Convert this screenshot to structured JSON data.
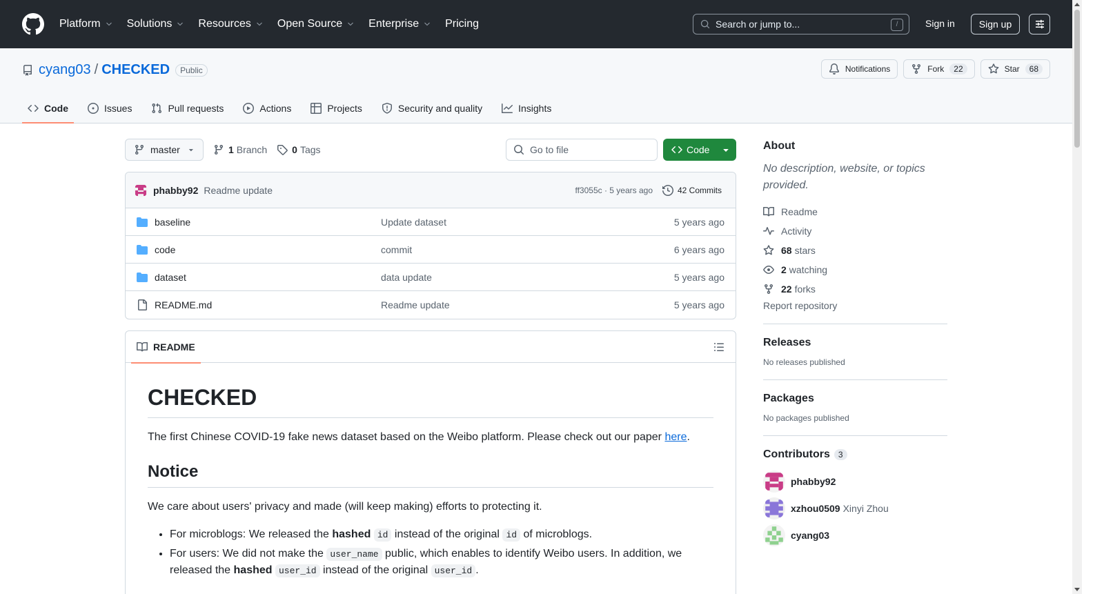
{
  "header": {
    "nav": [
      "Platform",
      "Solutions",
      "Resources",
      "Open Source",
      "Enterprise",
      "Pricing"
    ],
    "search_placeholder": "Search or jump to...",
    "search_key": "/",
    "sign_in": "Sign in",
    "sign_up": "Sign up"
  },
  "repo": {
    "owner": "cyang03",
    "separator": "/",
    "name": "CHECKED",
    "visibility": "Public",
    "notifications_label": "Notifications",
    "fork_label": "Fork",
    "fork_count": "22",
    "star_label": "Star",
    "star_count": "68"
  },
  "tabs": [
    "Code",
    "Issues",
    "Pull requests",
    "Actions",
    "Projects",
    "Security and quality",
    "Insights"
  ],
  "toolbar": {
    "branch": "master",
    "branch_count": "1",
    "branch_label": "Branch",
    "tag_count": "0",
    "tag_label": "Tags",
    "goto_placeholder": "Go to file",
    "code_button": "Code"
  },
  "commit": {
    "author": "phabby92",
    "message": "Readme update",
    "hash_time": "ff3055c · 5 years ago",
    "commits": "42 Commits"
  },
  "files": [
    {
      "name": "baseline",
      "type": "folder",
      "message": "Update dataset",
      "age": "5 years ago"
    },
    {
      "name": "code",
      "type": "folder",
      "message": "commit",
      "age": "6 years ago"
    },
    {
      "name": "dataset",
      "type": "folder",
      "message": "data update",
      "age": "5 years ago"
    },
    {
      "name": "README.md",
      "type": "file",
      "message": "Readme update",
      "age": "5 years ago"
    }
  ],
  "readme": {
    "tab": "README",
    "title": "CHECKED",
    "intro_before": "The first Chinese COVID-19 fake news dataset based on the Weibo platform. Please check out our paper ",
    "intro_link": "here",
    "intro_after": ".",
    "notice_heading": "Notice",
    "notice_text": "We care about users' privacy and made (will keep making) efforts to protecting it.",
    "bullet1": {
      "a": "For microblogs: We released the ",
      "b": "hashed",
      "c": "id",
      "d": " instead of the original ",
      "e": "id",
      "f": " of microblogs."
    },
    "bullet2": {
      "a": "For users: We did not make the ",
      "b": "user_name",
      "c": " public, which enables to identify Weibo users. In addition, we released the ",
      "d": "hashed",
      "e": "user_id",
      "f": " instead of the original ",
      "g": "user_id",
      "h": "."
    }
  },
  "sidebar": {
    "about_title": "About",
    "about_desc": "No description, website, or topics provided.",
    "readme": "Readme",
    "activity": "Activity",
    "stars_count": "68",
    "stars_label": "stars",
    "watching_count": "2",
    "watching_label": "watching",
    "forks_count": "22",
    "forks_label": "forks",
    "report": "Report repository",
    "releases_title": "Releases",
    "releases_text": "No releases published",
    "packages_title": "Packages",
    "packages_text": "No packages published",
    "contributors_title": "Contributors",
    "contributors_count": "3",
    "contributors": [
      {
        "login": "phabby92",
        "name": ""
      },
      {
        "login": "xzhou0509",
        "name": "Xinyi Zhou"
      },
      {
        "login": "cyang03",
        "name": ""
      }
    ]
  },
  "colors": {
    "header_bg": "#24292f",
    "link": "#0969da",
    "code_button": "#1f883d",
    "active_tab": "#fd8c73"
  }
}
